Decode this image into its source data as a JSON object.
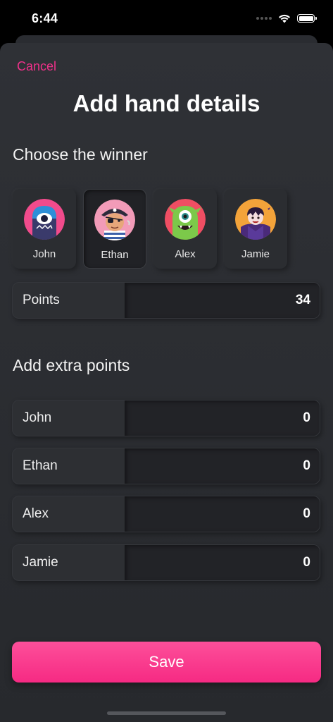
{
  "status_bar": {
    "time": "6:44"
  },
  "header": {
    "cancel_label": "Cancel",
    "title": "Add hand details"
  },
  "winner_section": {
    "heading": "Choose the winner",
    "players": [
      {
        "name": "John",
        "avatar": "cyclops-monster-icon",
        "selected": false
      },
      {
        "name": "Ethan",
        "avatar": "pirate-icon",
        "selected": true
      },
      {
        "name": "Alex",
        "avatar": "green-monster-icon",
        "selected": false
      },
      {
        "name": "Jamie",
        "avatar": "vampire-icon",
        "selected": false
      }
    ],
    "points": {
      "label": "Points",
      "value": "34"
    }
  },
  "extra_section": {
    "heading": "Add extra points",
    "rows": [
      {
        "label": "John",
        "value": "0"
      },
      {
        "label": "Ethan",
        "value": "0"
      },
      {
        "label": "Alex",
        "value": "0"
      },
      {
        "label": "Jamie",
        "value": "0"
      }
    ]
  },
  "save_label": "Save",
  "colors": {
    "accent": "#f0318a",
    "button": "#f83d8d",
    "background": "#2c2e33"
  }
}
